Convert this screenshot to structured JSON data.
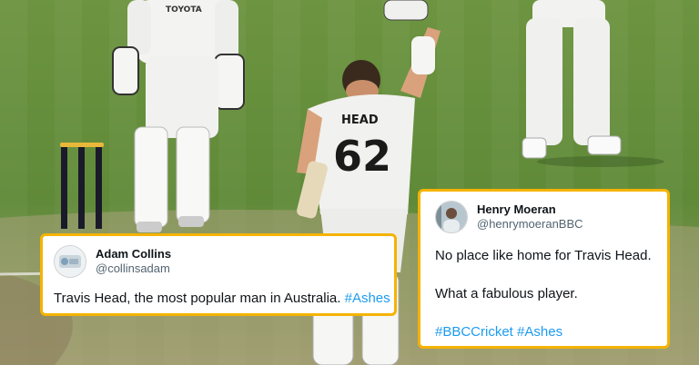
{
  "scene": {
    "description": "Cricketer wearing number 62 raising his arm walking off a grass pitch, teammates and stumps in background",
    "shirt_name": "HEAD",
    "shirt_number": "62",
    "sponsor": "TOYOTA",
    "colors": {
      "grass": "#5f8a38",
      "kit": "#f1f1ef",
      "accent_border": "#f5b301"
    }
  },
  "tweets": [
    {
      "name": "Adam Collins",
      "handle": "@collinsadam",
      "text": "Travis Head, the most popular man in Australia.",
      "hashtag": "#Ashes",
      "avatar_icon": "logo-avatar-icon"
    },
    {
      "name": "Henry Moeran",
      "handle": "@henrymoeranBBC",
      "line1": "No place like home for Travis Head.",
      "line2": "What a fabulous player.",
      "hashtag1": "#BBCCricket",
      "hashtag2": "#Ashes",
      "avatar_icon": "photo-avatar-icon"
    }
  ]
}
